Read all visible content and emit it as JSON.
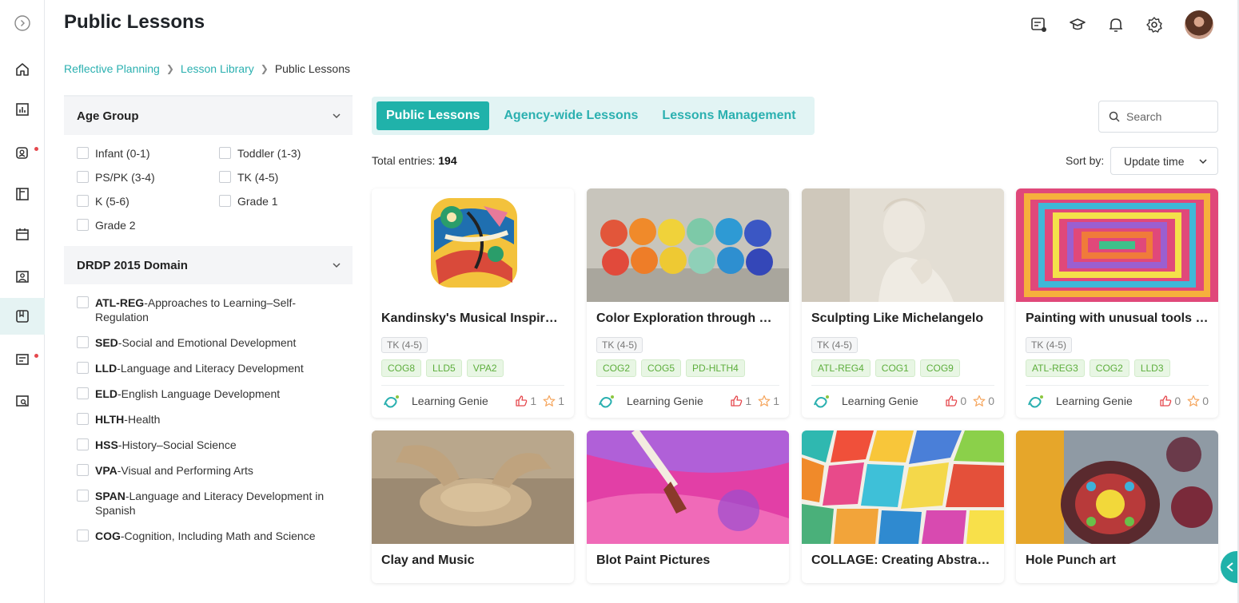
{
  "header": {
    "title": "Public Lessons"
  },
  "header_icons": [
    "collapse-sidebar-icon",
    "lesson-review-icon",
    "graduation-cap-icon",
    "bell-icon",
    "gear-icon",
    "user-avatar"
  ],
  "sidebar_icons": [
    "home-icon",
    "bar-chart-icon",
    "profile-icon",
    "layout-icon",
    "calendar-icon",
    "photo-icon",
    "lesson-book-icon",
    "checklist-icon",
    "search-doc-icon"
  ],
  "breadcrumb": {
    "items": [
      "Reflective Planning",
      "Lesson Library"
    ],
    "current": "Public Lessons"
  },
  "filters": {
    "age_group": {
      "title": "Age Group",
      "options": [
        "Infant (0-1)",
        "Toddler (1-3)",
        "PS/PK (3-4)",
        "TK (4-5)",
        "K (5-6)",
        "Grade 1",
        "Grade 2"
      ]
    },
    "domain": {
      "title": "DRDP 2015 Domain",
      "options": [
        {
          "code": "ATL-REG",
          "label": "-Approaches to Learning–Self-Regulation"
        },
        {
          "code": "SED",
          "label": "-Social and Emotional Development"
        },
        {
          "code": "LLD",
          "label": "-Language and Literacy Development"
        },
        {
          "code": "ELD",
          "label": "-English Language Development"
        },
        {
          "code": "HLTH",
          "label": "-Health"
        },
        {
          "code": "HSS",
          "label": "-History–Social Science"
        },
        {
          "code": "VPA",
          "label": "-Visual and Performing Arts"
        },
        {
          "code": "SPAN",
          "label": "-Language and Literacy Development in Spanish"
        },
        {
          "code": "COG",
          "label": "-Cognition, Including Math and Science"
        }
      ]
    }
  },
  "tabs": [
    {
      "label": "Public Lessons",
      "active": true
    },
    {
      "label": "Agency-wide Lessons",
      "active": false
    },
    {
      "label": "Lessons Management",
      "active": false
    }
  ],
  "search": {
    "placeholder": "Search"
  },
  "list": {
    "total_label": "Total entries:",
    "total": "194",
    "sort_label": "Sort by:",
    "sort_value": "Update time"
  },
  "lessons": [
    {
      "title": "Kandinsky's Musical Inspiration",
      "age": "TK (4-5)",
      "tags": [
        "COG8",
        "LLD5",
        "VPA2"
      ],
      "author": "Learning Genie",
      "likes": "1",
      "favorites": "1"
    },
    {
      "title": "Color Exploration through Eggs",
      "age": "TK (4-5)",
      "tags": [
        "COG2",
        "COG5",
        "PD-HLTH4"
      ],
      "author": "Learning Genie",
      "likes": "1",
      "favorites": "1"
    },
    {
      "title": "Sculpting Like Michelangelo",
      "age": "TK (4-5)",
      "tags": [
        "ATL-REG4",
        "COG1",
        "COG9"
      ],
      "author": "Learning Genie",
      "likes": "0",
      "favorites": "0"
    },
    {
      "title": "Painting with unusual tools and materials",
      "age": "TK (4-5)",
      "tags": [
        "ATL-REG3",
        "COG2",
        "LLD3"
      ],
      "author": "Learning Genie",
      "likes": "0",
      "favorites": "0"
    },
    {
      "title": "Clay and Music"
    },
    {
      "title": "Blot Paint Pictures"
    },
    {
      "title": "COLLAGE: Creating Abstract Art"
    },
    {
      "title": "Hole Punch art"
    }
  ],
  "colors": {
    "accent": "#20b2aa",
    "tag_green": "#5dae3c",
    "like_red": "#e5484d",
    "star_orange": "#f5a45b"
  }
}
